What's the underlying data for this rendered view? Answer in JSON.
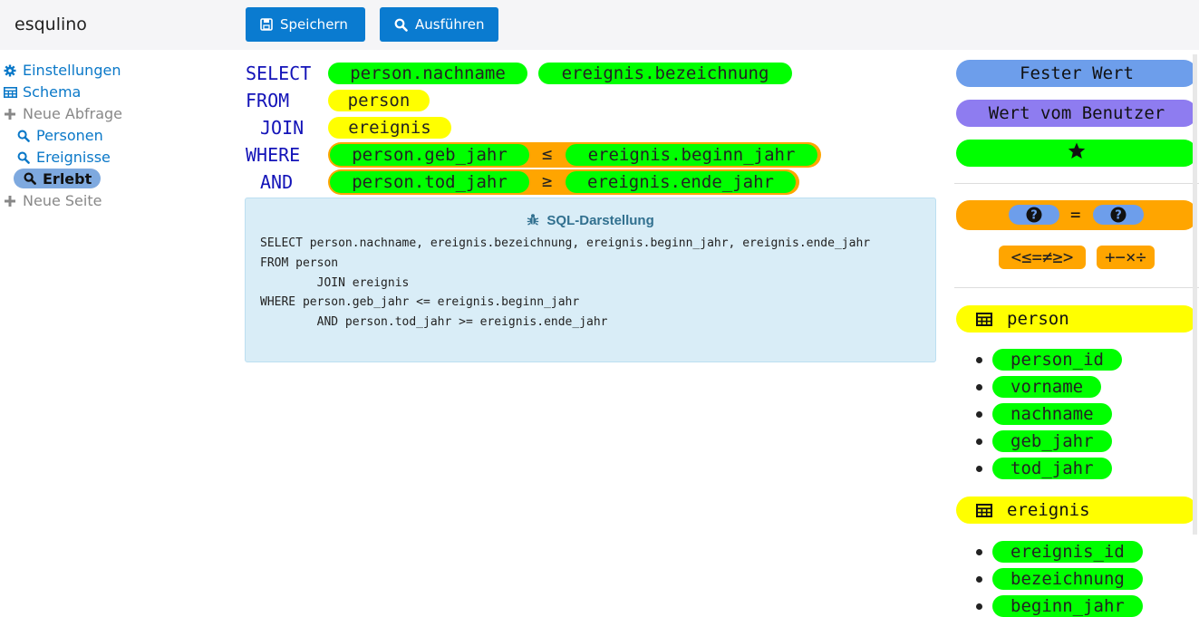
{
  "app": {
    "title": "esqulino"
  },
  "toolbar": {
    "save_label": "Speichern",
    "run_label": "Ausführen"
  },
  "nav": {
    "settings": "Einstellungen",
    "schema": "Schema",
    "new_query": "Neue Abfrage",
    "queries": [
      "Personen",
      "Ereignisse",
      "Erlebt"
    ],
    "active_query": "Erlebt",
    "new_page": "Neue Seite"
  },
  "query": {
    "select_kw": "SELECT",
    "from_kw": "FROM",
    "join_kw": "JOIN",
    "where_kw": "WHERE",
    "and_kw": "AND",
    "select_cols": [
      "person.nachname",
      "ereignis.bezeichnung"
    ],
    "from_table": "person",
    "join_table": "ereignis",
    "where": {
      "left": "person.geb_jahr",
      "op": "≤",
      "right": "ereignis.beginn_jahr"
    },
    "and": {
      "left": "person.tod_jahr",
      "op": "≥",
      "right": "ereignis.ende_jahr"
    }
  },
  "sql_panel": {
    "title": "SQL-Darstellung",
    "lines": [
      "SELECT person.nachname, ereignis.bezeichnung, ereignis.beginn_jahr, ereignis.ende_jahr",
      "FROM person",
      "        JOIN ereignis",
      "WHERE person.geb_jahr <= ereignis.beginn_jahr",
      "        AND person.tod_jahr >= ereignis.ende_jahr"
    ]
  },
  "palette": {
    "constant": "Fester Wert",
    "user_value": "Wert vom Benutzer",
    "star_icon": "star-icon",
    "expression_op": "=",
    "comparison_ops": "<≤=≠≥>",
    "arith_ops": "+−×÷",
    "tables": [
      {
        "name": "person",
        "columns": [
          "person_id",
          "vorname",
          "nachname",
          "geb_jahr",
          "tod_jahr"
        ]
      },
      {
        "name": "ereignis",
        "columns": [
          "ereignis_id",
          "bezeichnung",
          "beginn_jahr"
        ]
      }
    ]
  },
  "colors": {
    "primary": "#0a7bd0",
    "column_chip": "#00ff00",
    "table_chip": "#ffff00",
    "operator": "#ffa500",
    "keyword": "#1313b8"
  }
}
